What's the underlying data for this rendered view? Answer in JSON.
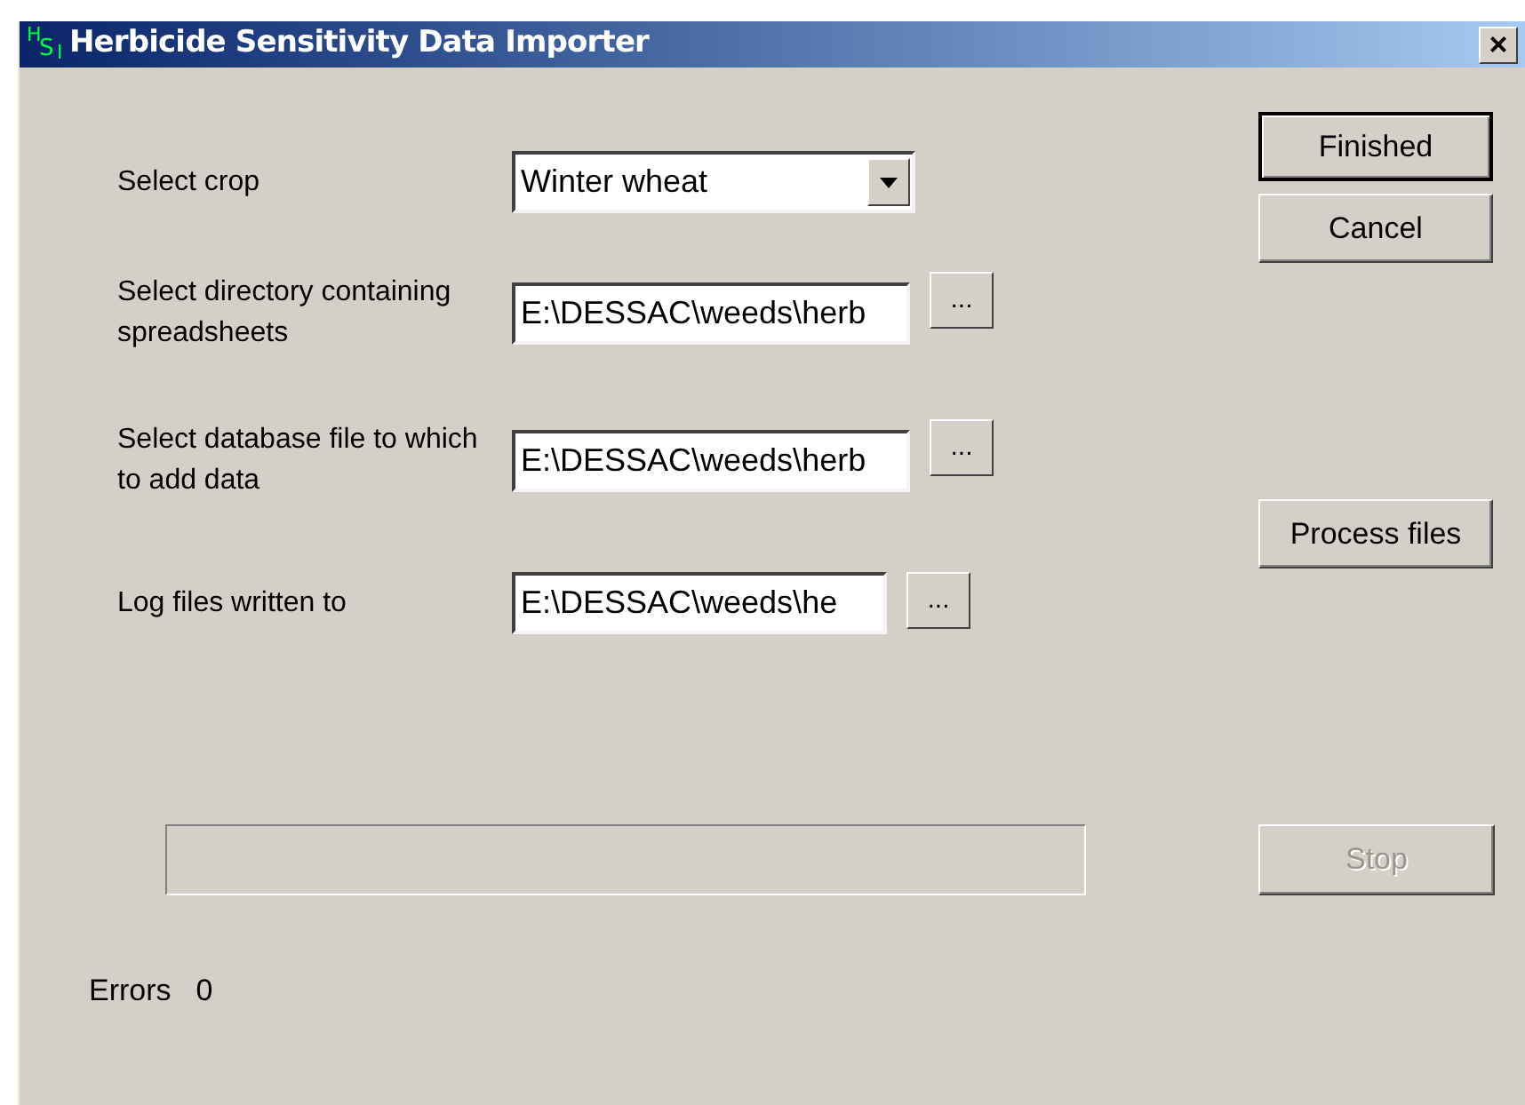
{
  "window": {
    "title": "Herbicide Sensitivity Data Importer",
    "logo_letters": [
      "H",
      "S",
      "I"
    ],
    "close": "×"
  },
  "form": [
    {
      "kind": "combo",
      "label": "Select crop",
      "value": "Winter wheat"
    },
    {
      "kind": "path",
      "label": "Select directory containing spreadsheets",
      "value": "E:\\DESSAC\\weeds\\herb",
      "browse": "..."
    },
    {
      "kind": "path",
      "label": "Select database file to which to add data",
      "value": "E:\\DESSAC\\weeds\\herb",
      "browse": "..."
    },
    {
      "kind": "path",
      "label": "Log files written to",
      "value": "E:\\DESSAC\\weeds\\he",
      "browse": "..."
    }
  ],
  "side_buttons": [
    {
      "label": "Finished",
      "default": true,
      "disabled": false
    },
    {
      "label": "Cancel",
      "default": false,
      "disabled": false
    },
    {
      "label": "Process files",
      "default": false,
      "disabled": false
    }
  ],
  "progress": {
    "level": 0
  },
  "stop_button": {
    "label": "Stop",
    "disabled": true
  },
  "errors": {
    "label": "Errors",
    "count": "0"
  }
}
